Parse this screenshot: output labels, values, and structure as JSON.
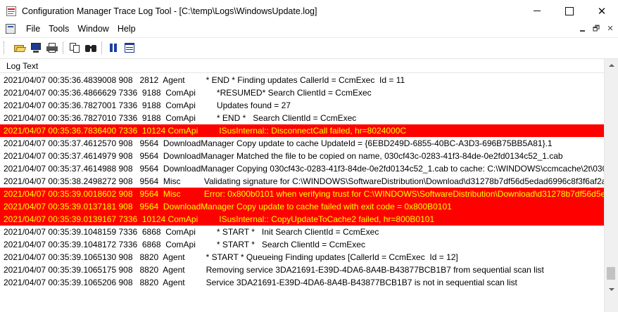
{
  "window": {
    "title": "Configuration Manager Trace Log Tool - [C:\\temp\\Logs\\WindowsUpdate.log]",
    "controls": {
      "minimize": "—",
      "maximize": "☐",
      "close": "✕"
    }
  },
  "menu": {
    "items": [
      "File",
      "Tools",
      "Window",
      "Help"
    ],
    "mdi_controls": {
      "minimize": "_",
      "restore": "🗗",
      "close": "✕"
    }
  },
  "toolbar": {
    "buttons": [
      {
        "icon": "open-folder-icon"
      },
      {
        "icon": "monitor-icon"
      },
      {
        "icon": "printer-icon"
      },
      {
        "icon": "copy-icon"
      },
      {
        "icon": "find-binoculars-icon"
      },
      {
        "icon": "pause-icon"
      },
      {
        "icon": "columns-view-icon"
      }
    ]
  },
  "log": {
    "column_header": "Log Text",
    "error_colors": {
      "background": "#ff0000",
      "text": "#ffff00"
    },
    "rows": [
      {
        "text": "2021/04/07 00:35:36.4839008 908   2812  Agent         * END * Finding updates CallerId = CcmExec  Id = 11",
        "error": false
      },
      {
        "text": "2021/04/07 00:35:36.4866629 7336  9188  ComApi         *RESUMED* Search ClientId = CcmExec",
        "error": false
      },
      {
        "text": "2021/04/07 00:35:36.7827001 7336  9188  ComApi         Updates found = 27",
        "error": false
      },
      {
        "text": "2021/04/07 00:35:36.7827010 7336  9188  ComApi         * END *   Search ClientId = CcmExec",
        "error": false
      },
      {
        "text": "2021/04/07 00:35:36.7836400 7336  10124 ComApi         ISusInternal:: DisconnectCall failed, hr=8024000C",
        "error": true
      },
      {
        "text": "2021/04/07 00:35:37.4612570 908   9564  DownloadManager Copy update to cache UpdateId = {6EBD249D-6855-40BC-A3D3-696B75BB5A81}.1",
        "error": false
      },
      {
        "text": "2021/04/07 00:35:37.4614979 908   9564  DownloadManager Matched the file to be copied on name, 030cf43c-0283-41f3-84de-0e2fd0134c52_1.cab",
        "error": false
      },
      {
        "text": "2021/04/07 00:35:37.4614988 908   9564  DownloadManager Copying 030cf43c-0283-41f3-84de-0e2fd0134c52_1.cab to cache: C:\\WINDOWS\\ccmcache\\2t\\030cf...",
        "error": false
      },
      {
        "text": "2021/04/07 00:35:38.2498272 908   9564  Misc          Validating signature for C:\\WINDOWS\\SoftwareDistribution\\Download\\d31278b7df56d5edad6996c8f3f6af2a8...",
        "error": false
      },
      {
        "text": "2021/04/07 00:35:39.0018602 908   9564  Misc          Error: 0x800b0101 when verifying trust for C:\\WINDOWS\\SoftwareDistribution\\Download\\d31278b7df56d5ed...",
        "error": true
      },
      {
        "text": "2021/04/07 00:35:39.0137181 908   9564  DownloadManager Copy update to cache failed with exit code = 0x800B0101",
        "error": true
      },
      {
        "text": "2021/04/07 00:35:39.0139167 7336  10124 ComApi         ISusInternal:: CopyUpdateToCache2 failed, hr=800B0101",
        "error": true
      },
      {
        "text": "2021/04/07 00:35:39.1048159 7336  6868  ComApi         * START *   Init Search ClientId = CcmExec",
        "error": false
      },
      {
        "text": "2021/04/07 00:35:39.1048172 7336  6868  ComApi         * START *   Search ClientId = CcmExec",
        "error": false
      },
      {
        "text": "2021/04/07 00:35:39.1065130 908   8820  Agent         * START * Queueing Finding updates [CallerId = CcmExec  Id = 12]",
        "error": false
      },
      {
        "text": "2021/04/07 00:35:39.1065175 908   8820  Agent         Removing service 3DA21691-E39D-4DA6-8A4B-B43877BCB1B7 from sequential scan list",
        "error": false
      },
      {
        "text": "2021/04/07 00:35:39.1065206 908   8820  Agent         Service 3DA21691-E39D-4DA6-8A4B-B43877BCB1B7 is not in sequential scan list",
        "error": false
      }
    ]
  }
}
